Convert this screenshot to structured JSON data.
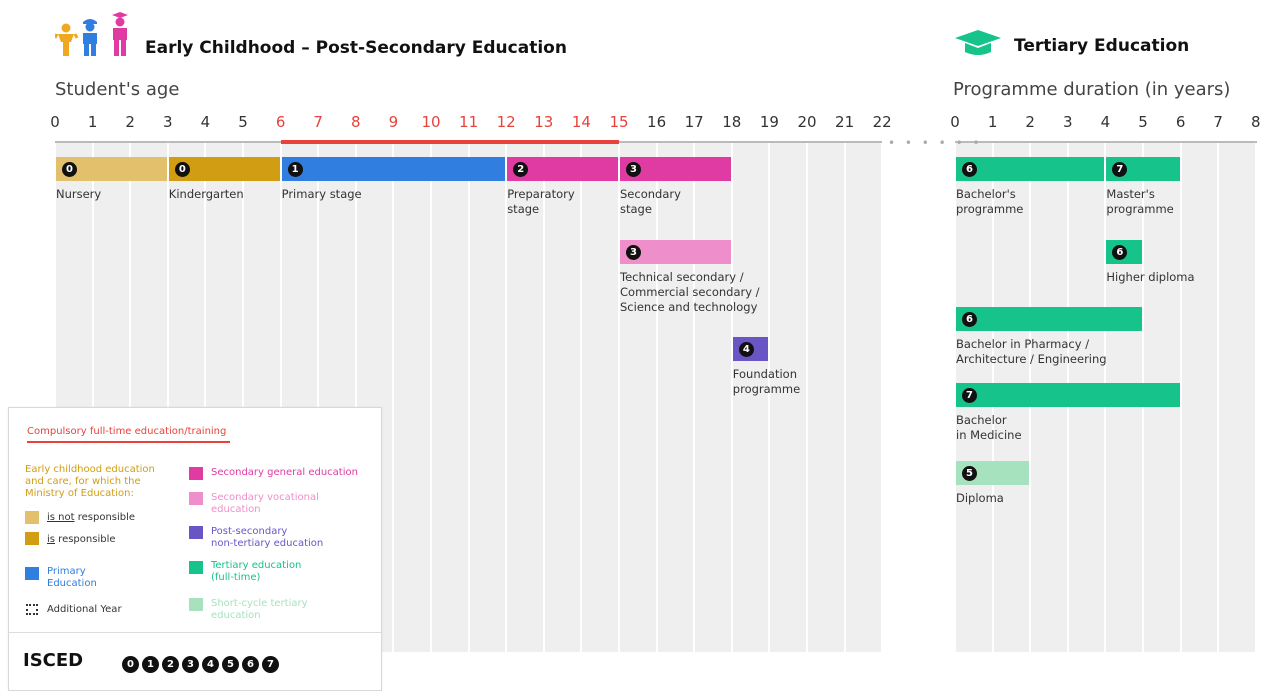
{
  "colors": {
    "nursery": "#e3c06b",
    "kindergarten": "#d19d13",
    "primary": "#2f7ee0",
    "secondary_general": "#e03ba3",
    "secondary_vocational": "#ee8fcb",
    "post_secondary": "#6a55c4",
    "tertiary": "#15c38b",
    "short_cycle": "#a7e2bf",
    "compulsory": "#e8423c"
  },
  "header": {
    "left_title": "Early Childhood – Post-Secondary Education",
    "right_title": "Tertiary Education",
    "left_icon": "children-icon",
    "right_icon": "graduation-cap-icon"
  },
  "axes": {
    "age_label": "Student's age",
    "duration_label": "Programme duration (in years)",
    "age_ticks": [
      "0",
      "1",
      "2",
      "3",
      "4",
      "5",
      "6",
      "7",
      "8",
      "9",
      "10",
      "11",
      "12",
      "13",
      "14",
      "15",
      "16",
      "17",
      "18",
      "19",
      "20",
      "21",
      "22"
    ],
    "compulsory_range": [
      6,
      15
    ],
    "duration_ticks": [
      "0",
      "1",
      "2",
      "3",
      "4",
      "5",
      "6",
      "7",
      "8"
    ]
  },
  "programmes": [
    {
      "name": "Nursery",
      "isced": "0",
      "start": 0,
      "end": 3,
      "color_key": "nursery",
      "axis": "age"
    },
    {
      "name": "Kindergarten",
      "isced": "0",
      "start": 3,
      "end": 6,
      "color_key": "kindergarten",
      "axis": "age"
    },
    {
      "name": "Primary stage",
      "isced": "1",
      "start": 6,
      "end": 12,
      "color_key": "primary",
      "axis": "age"
    },
    {
      "name": "Preparatory\nstage",
      "isced": "2",
      "start": 12,
      "end": 15,
      "color_key": "secondary_general",
      "axis": "age"
    },
    {
      "name": "Secondary\nstage",
      "isced": "3",
      "start": 15,
      "end": 18,
      "color_key": "secondary_general",
      "axis": "age"
    },
    {
      "name": "Technical secondary /\nCommercial secondary /\nScience and technology",
      "isced": "3",
      "start": 15,
      "end": 18,
      "color_key": "secondary_vocational",
      "axis": "age"
    },
    {
      "name": "Foundation\nprogramme",
      "isced": "4",
      "start": 18,
      "end": 19,
      "color_key": "post_secondary",
      "axis": "age"
    },
    {
      "name": "Bachelor's\nprogramme",
      "isced": "6",
      "start": 0,
      "end": 4,
      "color_key": "tertiary",
      "axis": "duration"
    },
    {
      "name": "Master's\nprogramme",
      "isced": "7",
      "start": 4,
      "end": 6,
      "color_key": "tertiary",
      "axis": "duration"
    },
    {
      "name": "Higher diploma",
      "isced": "6",
      "start": 4,
      "end": 5,
      "color_key": "tertiary",
      "axis": "duration"
    },
    {
      "name": "Bachelor in Pharmacy /\nArchitecture / Engineering",
      "isced": "6",
      "start": 0,
      "end": 5,
      "color_key": "tertiary",
      "axis": "duration"
    },
    {
      "name": "Bachelor\nin Medicine",
      "isced": "7",
      "start": 0,
      "end": 6,
      "color_key": "tertiary",
      "axis": "duration"
    },
    {
      "name": "Diploma",
      "isced": "5",
      "start": 0,
      "end": 2,
      "color_key": "short_cycle",
      "axis": "duration"
    }
  ],
  "legend": {
    "compulsory": "Compulsory full-time education/training",
    "ecec_heading": "Early childhood education\nand care, for which the\nMinistry of Education:",
    "ecec_not_prefix": "is not",
    "ecec_not_suffix": " responsible",
    "ecec_is_prefix": "is",
    "ecec_is_suffix": " responsible",
    "primary": "Primary\nEducation",
    "additional_year": "Additional Year",
    "secondary_general": "Secondary general education",
    "secondary_vocational": "Secondary vocational\neducation",
    "post_secondary": "Post-secondary\nnon-tertiary education",
    "tertiary": "Tertiary education\n(full-time)",
    "short_cycle": "Short-cycle tertiary\neducation",
    "isced_label": "ISCED",
    "isced_levels": [
      "0",
      "1",
      "2",
      "3",
      "4",
      "5",
      "6",
      "7"
    ]
  }
}
